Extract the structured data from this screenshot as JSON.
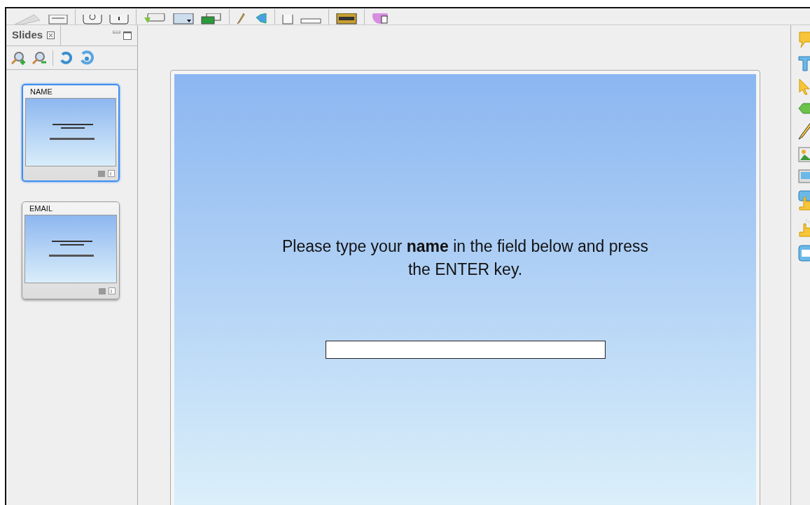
{
  "slides_panel": {
    "title": "Slides"
  },
  "slides": [
    {
      "title": "NAME",
      "selected": true
    },
    {
      "title": "EMAIL",
      "selected": false
    }
  ],
  "slide": {
    "text": "Please type your **name** in the field below and press the ENTER key."
  }
}
